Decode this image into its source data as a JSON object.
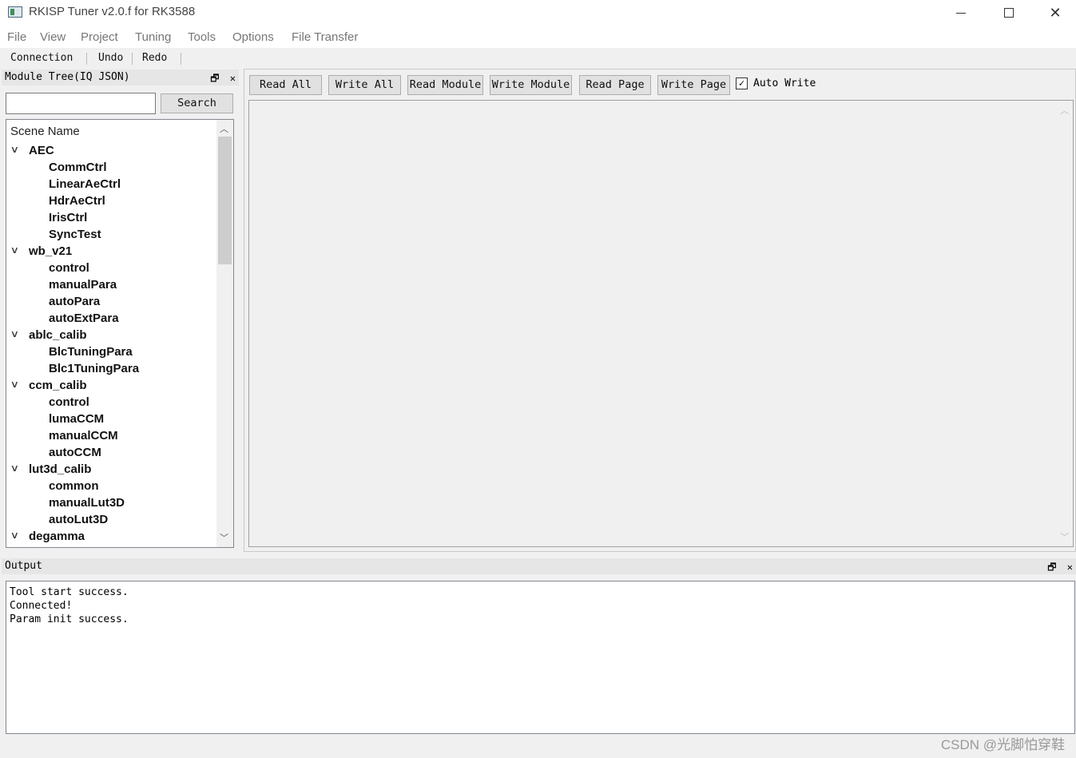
{
  "window": {
    "title": "RKISP Tuner v2.0.f for RK3588",
    "close_glyph": "✕"
  },
  "menu": [
    "File",
    "View",
    "Project",
    "Tuning",
    "Tools",
    "Options",
    "File Transfer"
  ],
  "toolbar": [
    "Connection",
    "Undo",
    "Redo"
  ],
  "module_dock": {
    "title": "Module Tree(IQ JSON)",
    "float_glyph": "🗗",
    "close_glyph": "✕",
    "search_value": "",
    "search_button": "Search"
  },
  "tree": {
    "header": "Scene Name",
    "rows": [
      {
        "label": "AEC",
        "level": 0
      },
      {
        "label": "CommCtrl",
        "level": 1
      },
      {
        "label": "LinearAeCtrl",
        "level": 1
      },
      {
        "label": "HdrAeCtrl",
        "level": 1
      },
      {
        "label": "IrisCtrl",
        "level": 1
      },
      {
        "label": "SyncTest",
        "level": 1
      },
      {
        "label": "wb_v21",
        "level": 0
      },
      {
        "label": "control",
        "level": 1
      },
      {
        "label": "manualPara",
        "level": 1
      },
      {
        "label": "autoPara",
        "level": 1
      },
      {
        "label": "autoExtPara",
        "level": 1
      },
      {
        "label": "ablc_calib",
        "level": 0
      },
      {
        "label": "BlcTuningPara",
        "level": 1
      },
      {
        "label": "Blc1TuningPara",
        "level": 1
      },
      {
        "label": "ccm_calib",
        "level": 0
      },
      {
        "label": "control",
        "level": 1
      },
      {
        "label": "lumaCCM",
        "level": 1
      },
      {
        "label": "manualCCM",
        "level": 1
      },
      {
        "label": "autoCCM",
        "level": 1
      },
      {
        "label": "lut3d_calib",
        "level": 0
      },
      {
        "label": "common",
        "level": 1
      },
      {
        "label": "manualLut3D",
        "level": 1
      },
      {
        "label": "autoLut3D",
        "level": 1
      },
      {
        "label": "degamma",
        "level": 0
      }
    ]
  },
  "actions": [
    "Read All",
    "Write All",
    "Read Module",
    "Write Module",
    "Read Page",
    "Write Page"
  ],
  "auto_write": {
    "label": "Auto Write",
    "checked": true,
    "check_glyph": "✓"
  },
  "output": {
    "title": "Output",
    "lines": [
      "Tool start success.",
      "Connected!",
      "Param init success."
    ]
  },
  "watermark": "CSDN @光脚怕穿鞋"
}
